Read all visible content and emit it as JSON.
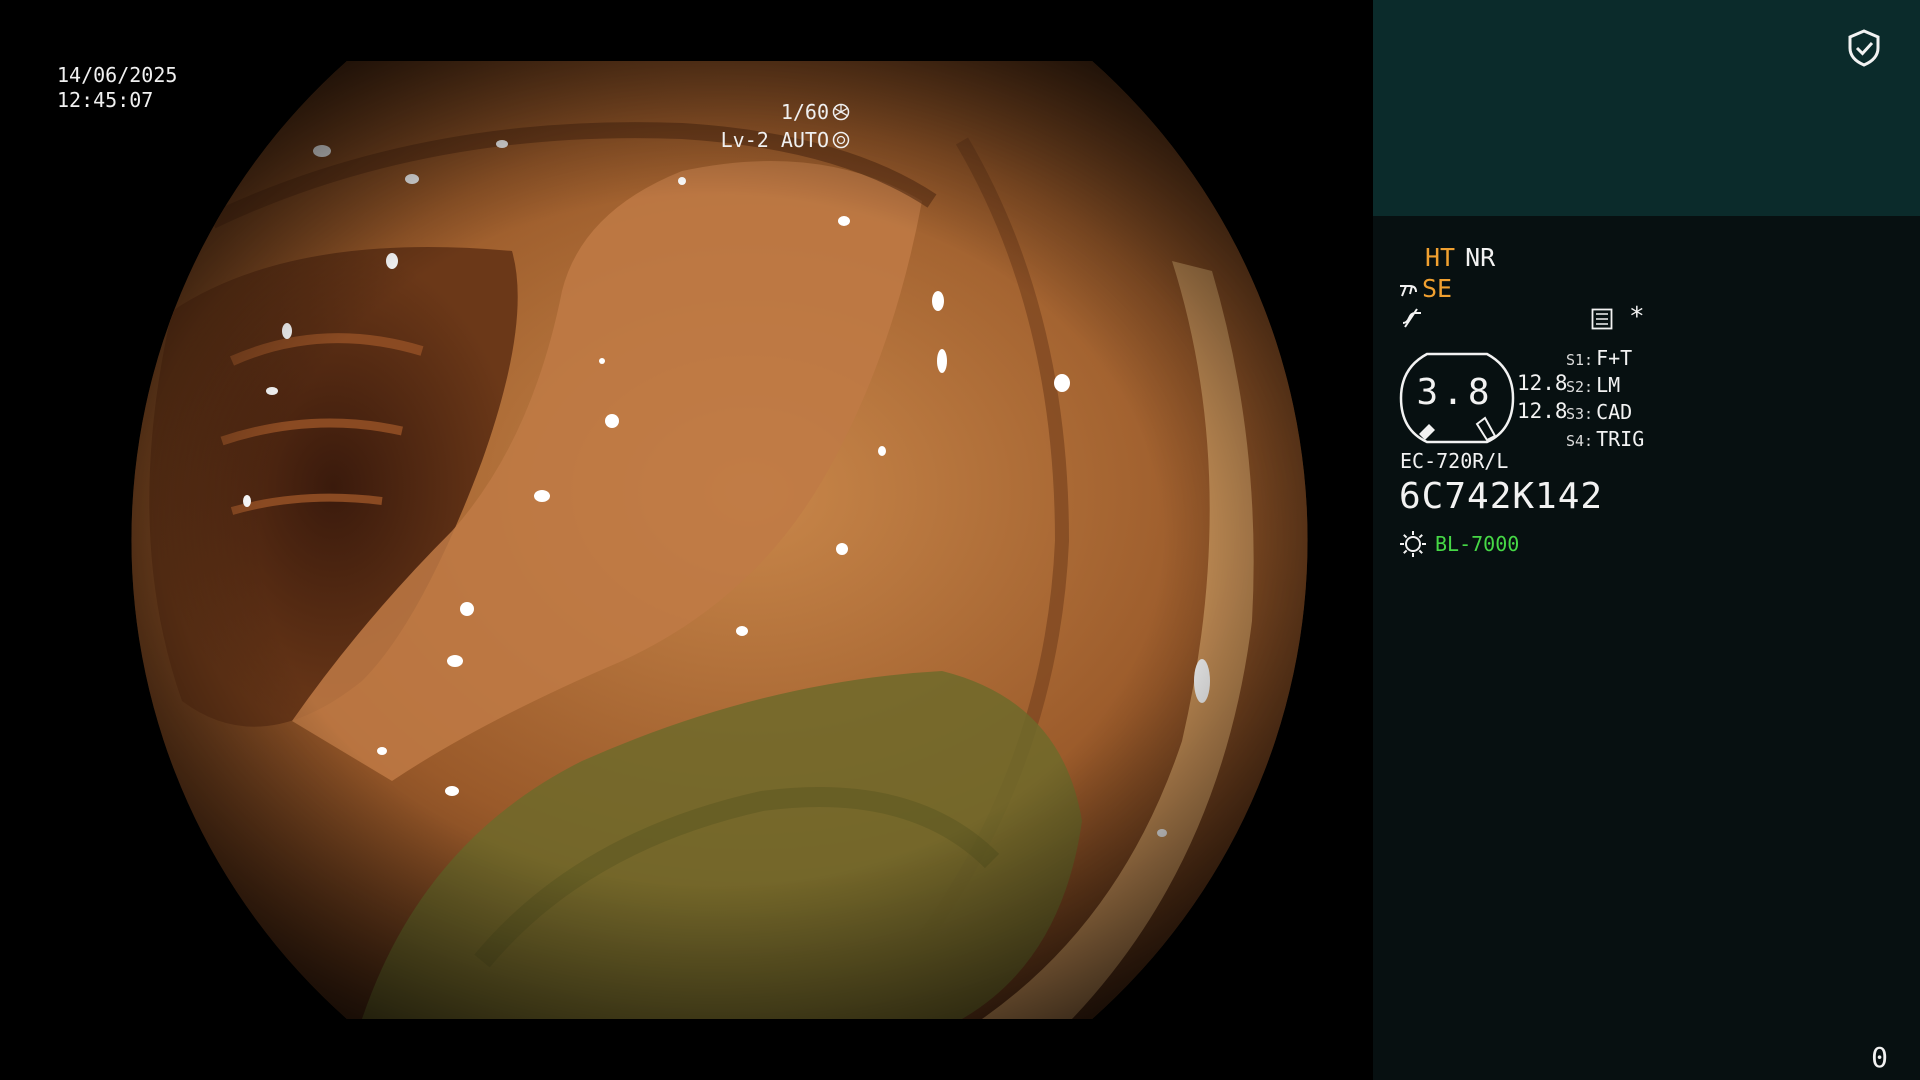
{
  "overlay": {
    "date": "14/06/2025",
    "time": "12:45:07",
    "shutter": "1/60",
    "iris": "Lv-2 AUTO"
  },
  "panel": {
    "modes": {
      "ht": "HT",
      "nr": "NR",
      "se": "SE"
    },
    "star": "*",
    "gauge": {
      "value": "3.8",
      "num_top": "12.8",
      "num_bottom": "12.8"
    },
    "scope_switches": [
      {
        "key": "S1:",
        "value": "F+T"
      },
      {
        "key": "S2:",
        "value": "LM"
      },
      {
        "key": "S3:",
        "value": "CAD"
      },
      {
        "key": "S4:",
        "value": "TRIG"
      }
    ],
    "scope_model": "EC-720R/L",
    "scope_serial": "6C742K142",
    "light_source": "BL-7000",
    "counter": "0"
  },
  "colors": {
    "panel_top": "#0b2b2b",
    "panel_bg": "#071011",
    "accent_orange": "#f0a030",
    "accent_green": "#46d846"
  },
  "icons": [
    "shutter-icon",
    "iris-icon",
    "shield-check-icon",
    "scope-tip-icon",
    "waveform-icon",
    "menu-list-icon",
    "light-bulb-icon"
  ]
}
